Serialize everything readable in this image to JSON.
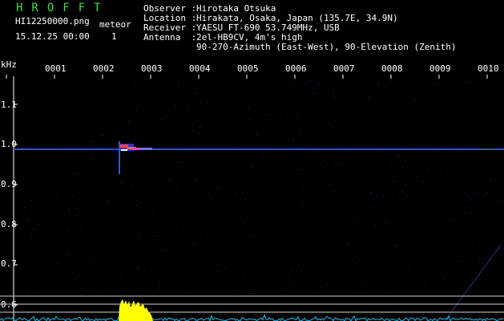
{
  "header": {
    "app_title": "HROFFT",
    "filename": "HI12250000.png",
    "timestamp": "15.12.25 00:00",
    "meteor_label": "meteor",
    "meteor_count": "1",
    "observer_key": "Observer :",
    "observer": "Hirotaka Otsuka",
    "location_key": "Location :",
    "location": "Hirakata, Osaka, Japan (135.7E, 34.9N)",
    "receiver_key": "Receiver :",
    "receiver": "YAESU FT-690 53.749MHz, USB",
    "antenna_key": "Antenna  :",
    "antenna": "2el-HB9CV, 4m's high",
    "antenna_line2": "90-270-Azimuth (East-West), 90-Elevation (Zenith)"
  },
  "axis": {
    "y_unit": "kHz",
    "y_ticks": [
      "1.1",
      "1.0",
      "0.9",
      "0.8",
      "0.7",
      "0.6"
    ],
    "x_ticks": [
      "0001",
      "0002",
      "0003",
      "0004",
      "0005",
      "0006",
      "0007",
      "0008",
      "0009",
      "0010"
    ]
  },
  "colors": {
    "background": "#000000",
    "text": "#ffffff",
    "title": "#3ddc3d",
    "carrier": "#3a5cff",
    "echo": "#ff4040",
    "signal_bar": "#ffff00",
    "noise_floor": "#00c8ff"
  }
}
